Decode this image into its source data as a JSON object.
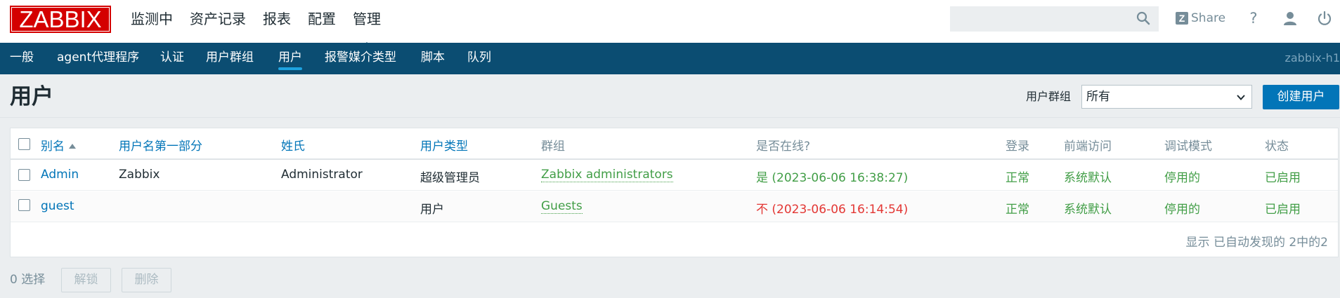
{
  "app": {
    "logo": "ZABBIX",
    "server_name": "zabbix-h1"
  },
  "main_menu": [
    {
      "label": "监测中"
    },
    {
      "label": "资产记录"
    },
    {
      "label": "报表"
    },
    {
      "label": "配置"
    },
    {
      "label": "管理",
      "active": true
    }
  ],
  "header": {
    "search_placeholder": "",
    "share_label": "Share",
    "help_label": "?"
  },
  "sub_menu": [
    {
      "label": "一般"
    },
    {
      "label": "agent代理程序"
    },
    {
      "label": "认证"
    },
    {
      "label": "用户群组"
    },
    {
      "label": "用户",
      "active": true
    },
    {
      "label": "报警媒介类型"
    },
    {
      "label": "脚本"
    },
    {
      "label": "队列"
    }
  ],
  "page": {
    "title": "用户",
    "filter_label": "用户群组",
    "filter_value": "所有",
    "create_button": "创建用户"
  },
  "table": {
    "columns": [
      "别名",
      "用户名第一部分",
      "姓氏",
      "用户类型",
      "群组",
      "是否在线?",
      "登录",
      "前端访问",
      "调试模式",
      "状态"
    ],
    "sorted_column": "别名",
    "sort_direction": "ascending",
    "rows": [
      {
        "alias": "Admin",
        "name": "Zabbix",
        "surname": "Administrator",
        "type": "超级管理员",
        "group": "Zabbix administrators",
        "online": "是 (2023-06-06 16:38:27)",
        "online_status": "yes",
        "login": "正常",
        "frontend": "系统默认",
        "debug": "停用的",
        "status": "已启用"
      },
      {
        "alias": "guest",
        "name": "",
        "surname": "",
        "type": "用户",
        "group": "Guests",
        "online": "不 (2023-06-06 16:14:54)",
        "online_status": "no",
        "login": "正常",
        "frontend": "系统默认",
        "debug": "停用的",
        "status": "已启用"
      }
    ],
    "footer": "显示 已自动发现的 2中的2"
  },
  "actions": {
    "selected": "0 选择",
    "unblock": "解锁",
    "delete": "删除"
  },
  "colors": {
    "brand": "#d40000",
    "nav": "#0b4d72",
    "primary": "#0275b8",
    "green": "#429e47",
    "red": "#e33734"
  }
}
